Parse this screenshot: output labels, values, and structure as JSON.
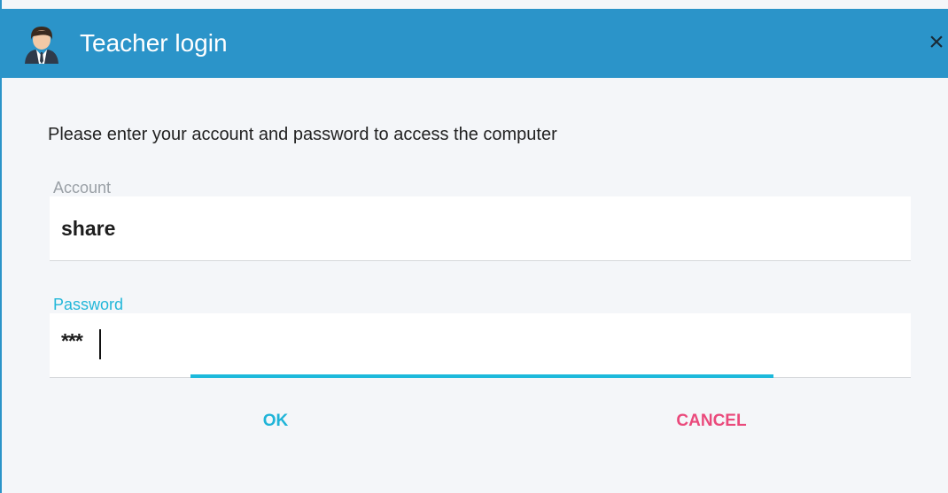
{
  "window": {
    "title": "Teacher login",
    "app_icon": "teacher-avatar-icon",
    "close_glyph": "×"
  },
  "dialog": {
    "instruction": "Please enter your account and password to access the computer",
    "account": {
      "label": "Account",
      "value": "share"
    },
    "password": {
      "label": "Password",
      "value": "***"
    },
    "ok_label": "OK",
    "cancel_label": "CANCEL"
  },
  "colors": {
    "titlebar": "#2b94c9",
    "accent": "#1cb9db",
    "cancel": "#ea4a7c",
    "background": "#f4f6f9"
  }
}
